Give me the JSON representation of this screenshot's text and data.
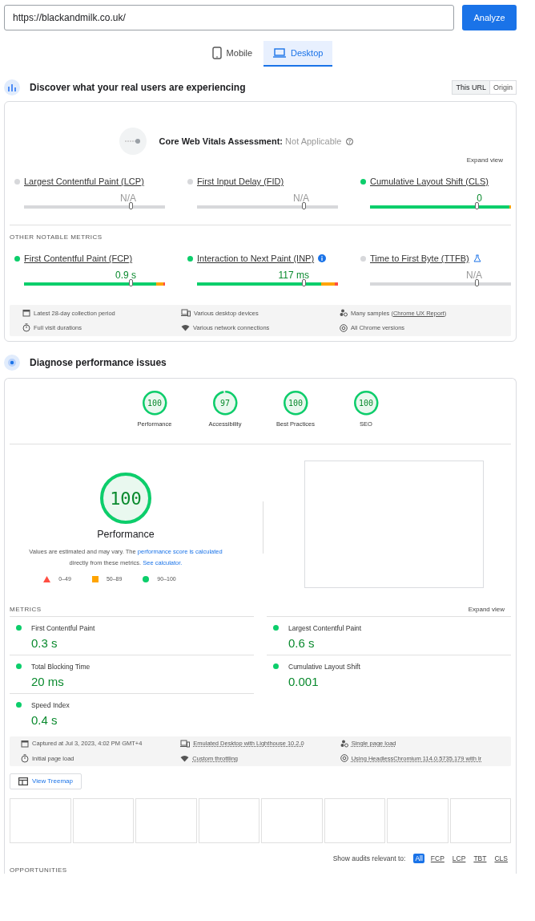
{
  "url_bar": {
    "value": "https://blackandmilk.co.uk/",
    "button": "Analyze"
  },
  "device_tabs": [
    {
      "label": "Mobile",
      "selected": false
    },
    {
      "label": "Desktop",
      "selected": true
    }
  ],
  "field_section": {
    "title": "Discover what your real users are experiencing",
    "scope_toggle": [
      {
        "label": "This URL",
        "selected": true
      },
      {
        "label": "Origin",
        "selected": false
      }
    ],
    "assessment": {
      "label": "Core Web Vitals Assessment:",
      "value": "Not Applicable"
    },
    "expand": "Expand view",
    "core_metrics": [
      {
        "name": "Largest Contentful Paint (LCP)",
        "value": "N/A",
        "color": "#d7d8db",
        "marker": {
          "level": 0.75
        },
        "segments": [
          {
            "color": "#d7d8db",
            "level": 1
          }
        ]
      },
      {
        "name": "First Input Delay (FID)",
        "value": "N/A",
        "color": "#d7d8db",
        "marker": {
          "level": 0.75
        },
        "segments": [
          {
            "color": "#d7d8db",
            "level": 1
          }
        ]
      },
      {
        "name": "Cumulative Layout Shift (CLS)",
        "value": "0",
        "color": "#0cce6b",
        "marker": {
          "level": 0.75
        },
        "segments": [
          {
            "color": "#0cce6b",
            "level": 0.99
          },
          {
            "color": "#ffa400",
            "level": 0.01
          }
        ]
      }
    ],
    "other_heading": "OTHER NOTABLE METRICS",
    "other_metrics": [
      {
        "name": "First Contentful Paint (FCP)",
        "value": "0.9 s",
        "color": "#0cce6b",
        "marker": {
          "level": 0.75
        },
        "segments": [
          {
            "color": "#0cce6b",
            "level": 0.94
          },
          {
            "color": "#ffa400",
            "level": 0.05
          },
          {
            "color": "#ff4e42",
            "level": 0.01
          }
        ]
      },
      {
        "name": "Interaction to Next Paint (INP)",
        "value": "117 ms",
        "color": "#0cce6b",
        "kind": "info",
        "marker": {
          "level": 0.75
        },
        "segments": [
          {
            "color": "#0cce6b",
            "level": 0.88
          },
          {
            "color": "#ffa400",
            "level": 0.1
          },
          {
            "color": "#ff4e42",
            "level": 0.02
          }
        ]
      },
      {
        "name": "Time to First Byte (TTFB)",
        "value": "N/A",
        "color": "#d7d8db",
        "kind": "experimental",
        "marker": {
          "level": 0.75
        },
        "segments": [
          {
            "color": "#d7d8db",
            "level": 1
          }
        ]
      }
    ],
    "details": [
      {
        "text": "Latest 28-day collection period"
      },
      {
        "text": "Various desktop devices"
      },
      {
        "text": "Many samples (",
        "link": "Chrome UX Report",
        "after": ")"
      },
      {
        "text": "Full visit durations"
      },
      {
        "text": "Various network connections"
      },
      {
        "text": "All Chrome versions"
      }
    ]
  },
  "lab_section": {
    "title": "Diagnose performance issues",
    "gauges": [
      {
        "score": "100",
        "label": "Performance",
        "level": 1
      },
      {
        "score": "97",
        "label": "Accessibility",
        "level": 0.97
      },
      {
        "score": "100",
        "label": "Best Practices",
        "level": 1
      },
      {
        "score": "100",
        "label": "SEO",
        "level": 1
      }
    ],
    "main_gauge": {
      "score": "100",
      "label": "Performance",
      "level": 1
    },
    "note": {
      "before": "Values are estimated and may vary. The ",
      "link1": "performance score is calculated",
      "middle": " directly from these metrics. ",
      "link2": "See calculator."
    },
    "legend": [
      {
        "kind": "poor",
        "text": "0–49"
      },
      {
        "kind": "average",
        "text": "50–89"
      },
      {
        "kind": "good",
        "text": "90–100"
      }
    ],
    "metrics_heading": "METRICS",
    "expand": "Expand view",
    "metrics": [
      {
        "name": "First Contentful Paint",
        "value": "0.3 s",
        "color": "#0cce6b"
      },
      {
        "name": "Largest Contentful Paint",
        "value": "0.6 s",
        "color": "#0cce6b"
      },
      {
        "name": "Total Blocking Time",
        "value": "20 ms",
        "color": "#0cce6b"
      },
      {
        "name": "Cumulative Layout Shift",
        "value": "0.001",
        "color": "#0cce6b"
      },
      {
        "name": "Speed Index",
        "value": "0.4 s",
        "color": "#0cce6b"
      }
    ],
    "run_info": [
      {
        "text": "Captured at Jul 3, 2023, 4:02 PM GMT+4",
        "dotted": false
      },
      {
        "text": "Emulated Desktop with Lighthouse 10.2.0",
        "dotted": true
      },
      {
        "text": "Single page load",
        "dotted": true
      },
      {
        "text": "Initial page load",
        "dotted": false
      },
      {
        "text": "Custom throttling",
        "dotted": true
      },
      {
        "text": "Using HeadlessChromium 114.0.5735.179 with lr",
        "dotted": true
      }
    ],
    "treemap_button": "View Treemap",
    "filter": {
      "label": "Show audits relevant to:",
      "options": [
        {
          "label": "All",
          "selected": true
        },
        {
          "label": "FCP",
          "selected": false
        },
        {
          "label": "LCP",
          "selected": false
        },
        {
          "label": "TBT",
          "selected": false
        },
        {
          "label": "CLS",
          "selected": false
        }
      ]
    },
    "next_heading": "OPPORTUNITIES"
  }
}
